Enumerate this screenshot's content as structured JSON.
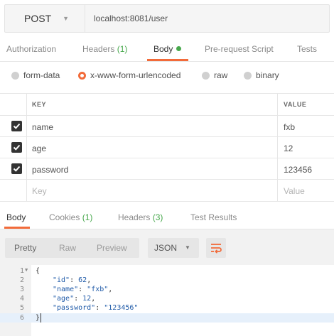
{
  "request": {
    "method": "POST",
    "url": "localhost:8081/user"
  },
  "request_tabs": [
    {
      "label": "Authorization",
      "count": ""
    },
    {
      "label": "Headers",
      "count": "(1)"
    },
    {
      "label": "Body",
      "count": ""
    },
    {
      "label": "Pre-request Script",
      "count": ""
    },
    {
      "label": "Tests",
      "count": ""
    }
  ],
  "body_types": [
    "form-data",
    "x-www-form-urlencoded",
    "raw",
    "binary"
  ],
  "body_type_selected": "x-www-form-urlencoded",
  "table": {
    "headers": {
      "key": "KEY",
      "value": "VALUE"
    },
    "rows": [
      {
        "key": "name",
        "value": "fxb",
        "checked": true
      },
      {
        "key": "age",
        "value": "12",
        "checked": true
      },
      {
        "key": "password",
        "value": "123456",
        "checked": true
      }
    ],
    "placeholder": {
      "key": "Key",
      "value": "Value"
    }
  },
  "response_tabs": [
    {
      "label": "Body",
      "count": ""
    },
    {
      "label": "Cookies",
      "count": "(1)"
    },
    {
      "label": "Headers",
      "count": "(3)"
    },
    {
      "label": "Test Results",
      "count": ""
    }
  ],
  "toolbar": {
    "formats": [
      "Pretty",
      "Raw",
      "Preview"
    ],
    "format_selected": "Pretty",
    "language": "JSON"
  },
  "code": {
    "line_numbers": [
      "1",
      "2",
      "3",
      "4",
      "5",
      "6"
    ],
    "open_brace": "{",
    "close_brace": "}",
    "fields": [
      {
        "key": "\"id\"",
        "value": "62",
        "type": "number",
        "comma": ","
      },
      {
        "key": "\"name\"",
        "value": "\"fxb\"",
        "type": "string",
        "comma": ","
      },
      {
        "key": "\"age\"",
        "value": "12",
        "type": "number",
        "comma": ","
      },
      {
        "key": "\"password\"",
        "value": "\"123456\"",
        "type": "string",
        "comma": ""
      }
    ]
  },
  "colors": {
    "accent": "#f26b3a",
    "count_green": "#47a84c",
    "json_value": "#1f5aa8"
  }
}
